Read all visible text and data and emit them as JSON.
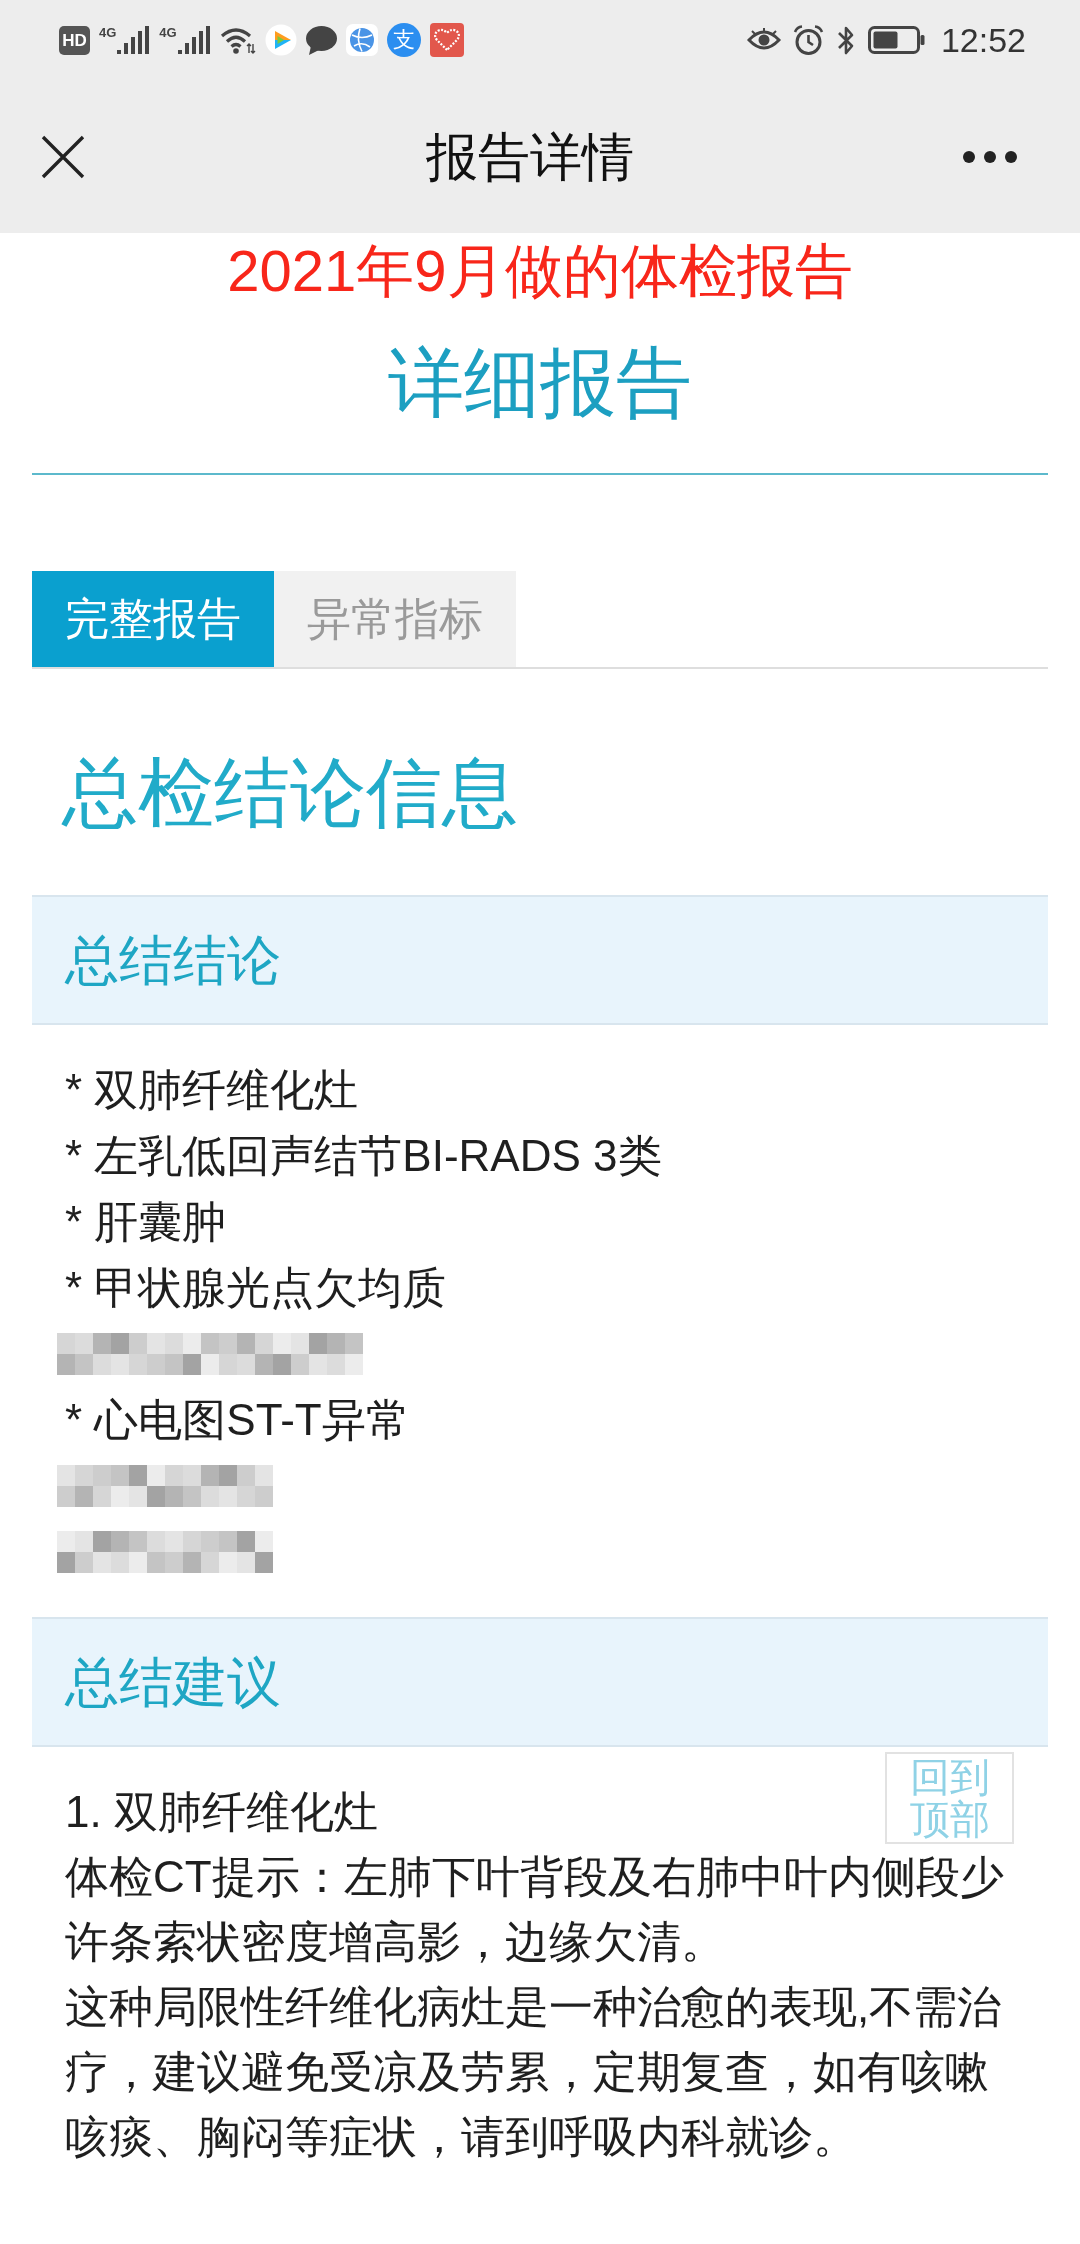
{
  "status_bar": {
    "hd": "HD",
    "networks": [
      "4G",
      "4G"
    ],
    "app_glyph": "支",
    "time": "12:52"
  },
  "header": {
    "title": "报告详情"
  },
  "note": "2021年9月做的体检报告",
  "report_title": "详细报告",
  "tabs": [
    {
      "label": "完整报告",
      "selected": true
    },
    {
      "label": "异常指标",
      "selected": false
    }
  ],
  "section_title": "总检结论信息",
  "conclusions": {
    "heading": "总结结论",
    "items": [
      {
        "kind": "text",
        "text": "* 双肺纤维化灶"
      },
      {
        "kind": "text",
        "text": "* 左乳低回声结节BI-RADS 3类"
      },
      {
        "kind": "text",
        "text": "* 肝囊肿"
      },
      {
        "kind": "text",
        "text": "* 甲状腺光点欠均质"
      },
      {
        "kind": "redacted"
      },
      {
        "kind": "text",
        "text": "* 心电图ST-T异常"
      },
      {
        "kind": "redacted"
      },
      {
        "kind": "redacted"
      }
    ]
  },
  "advice": {
    "heading": "总结建议",
    "lines": [
      "1. 双肺纤维化灶",
      "体检CT提示：左肺下叶背段及右肺中叶内侧段少许条索状密度增高影，边缘欠清。",
      "这种局限性纤维化病灶是一种治愈的表现,不需治疗，建议避免受凉及劳累，定期复查，如有咳嗽咳痰、胸闷等症状，请到呼吸内科就诊。"
    ]
  },
  "back_to_top": "回到顶部"
}
